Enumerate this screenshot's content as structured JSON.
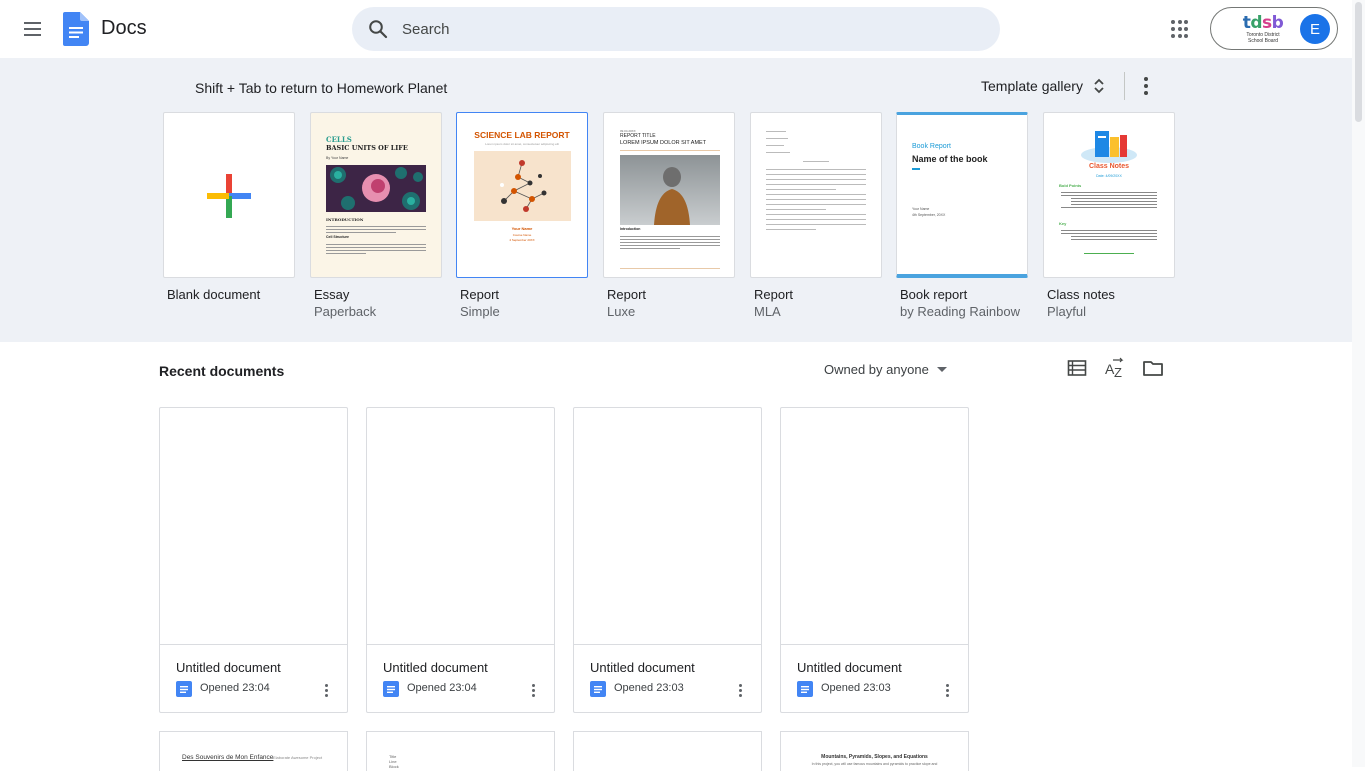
{
  "header": {
    "app_title": "Docs",
    "search_placeholder": "Search",
    "account_initial": "E",
    "org_logo_text": "tdsb",
    "org_logo_sub": "Toronto District School Board"
  },
  "templates": {
    "hint": "Shift + Tab to return to Homework Planet",
    "gallery_label": "Template gallery",
    "items": [
      {
        "name": "Blank document",
        "sub": ""
      },
      {
        "name": "Essay",
        "sub": "Paperback"
      },
      {
        "name": "Report",
        "sub": "Simple"
      },
      {
        "name": "Report",
        "sub": "Luxe"
      },
      {
        "name": "Report",
        "sub": "MLA"
      },
      {
        "name": "Book report",
        "sub": "by Reading Rainbow"
      },
      {
        "name": "Class notes",
        "sub": "Playful"
      }
    ],
    "thumb_text": {
      "essay_title": "CELLS",
      "essay_subtitle": "BASIC UNITS OF LIFE",
      "essay_name": "By Your Name",
      "essay_intro": "INTRODUCTION",
      "essay_cell": "Cell Structure",
      "science_title": "SCIENCE LAB REPORT",
      "science_tagline": "Lorem ipsum dolor sit amet, consectetuer adipiscing elit",
      "science_name": "Your Name",
      "science_course": "Course Name",
      "science_date": "4 September 20XX",
      "luxe_label": "09.04.20XX",
      "luxe_title": "REPORT TITLE",
      "luxe_subtitle": "LOREM IPSUM DOLOR SIT AMET",
      "luxe_intro": "Introduction",
      "book_label": "Book Report",
      "book_title": "Name of the book",
      "book_author": "Your Name",
      "book_date": "4th September, 20XX",
      "class_title": "Class Notes",
      "class_date": "Date: 4/09/20XX",
      "class_section1": "Bold Points",
      "class_section2": "Key"
    }
  },
  "recent": {
    "title": "Recent documents",
    "filter_label": "Owned by anyone",
    "documents": [
      {
        "title": "Untitled document",
        "opened": "Opened 23:04"
      },
      {
        "title": "Untitled document",
        "opened": "Opened 23:04"
      },
      {
        "title": "Untitled document",
        "opened": "Opened 23:03"
      },
      {
        "title": "Untitled document",
        "opened": "Opened 23:03"
      }
    ],
    "row2_snippets": {
      "doc1_title": "Des Souvenirs de Mon Enfance",
      "doc1_author": "Elaborate Awesome Project",
      "doc2_lines": [
        "Title",
        "Line",
        "Block"
      ],
      "doc4_title": "Mountains, Pyramids, Slopes, and Equations",
      "doc4_line": "In this project, you will use famous mountains and pyramids to practice slope and"
    }
  },
  "colors": {
    "accent": "#1a73e8",
    "band_bg": "#eef1f6",
    "docs_blue": "#4285f4"
  }
}
